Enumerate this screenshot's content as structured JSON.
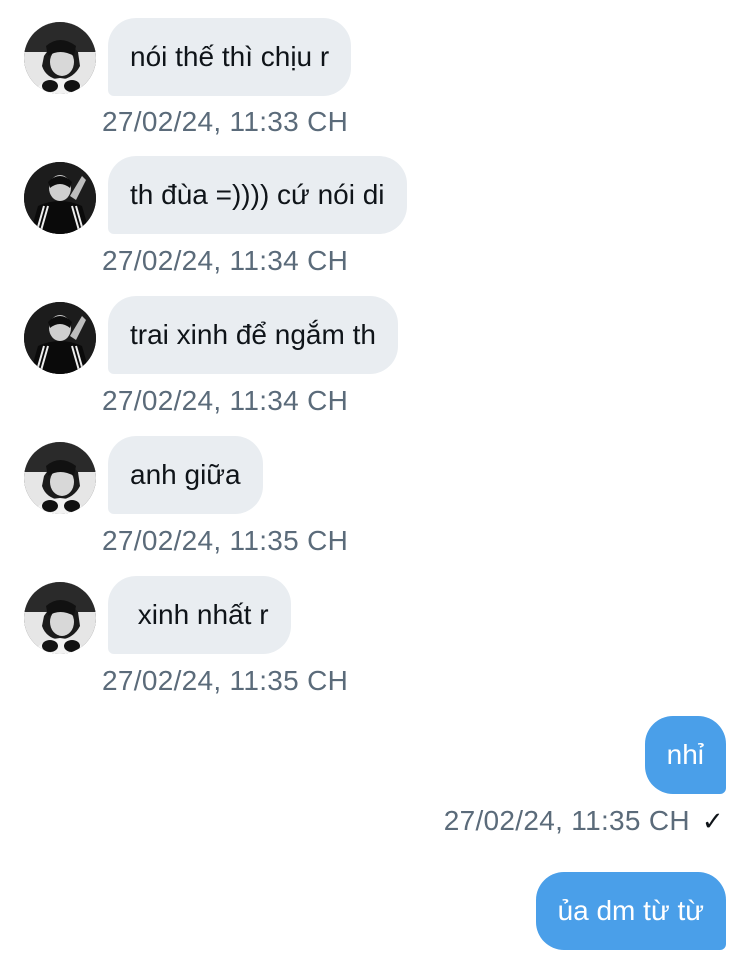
{
  "messages": [
    {
      "direction": "in",
      "text": "nói thế thì chịu r",
      "timestamp": "27/02/24, 11:33 CH",
      "avatar": "profile-photo-headphones"
    },
    {
      "direction": "in",
      "text": "th đùa =)))) cứ nói di",
      "timestamp": "27/02/24, 11:34 CH",
      "avatar": "profile-photo-tracksuit"
    },
    {
      "direction": "in",
      "text": "trai xinh để ngắm th",
      "timestamp": "27/02/24, 11:34 CH",
      "avatar": "profile-photo-tracksuit"
    },
    {
      "direction": "in",
      "text": "anh giữa",
      "timestamp": "27/02/24, 11:35 CH",
      "avatar": "profile-photo-headphones"
    },
    {
      "direction": "in",
      "text": " xinh nhất r",
      "timestamp": "27/02/24, 11:35 CH",
      "avatar": "profile-photo-headphones"
    },
    {
      "direction": "out",
      "text": "nhỉ",
      "timestamp": "27/02/24, 11:35 CH",
      "status": "✓"
    },
    {
      "direction": "out",
      "text": "ủa dm từ từ"
    }
  ],
  "colors": {
    "incoming_bubble": "#e9edf1",
    "outgoing_bubble": "#4a9fe9",
    "timestamp": "#5b6b7a"
  }
}
